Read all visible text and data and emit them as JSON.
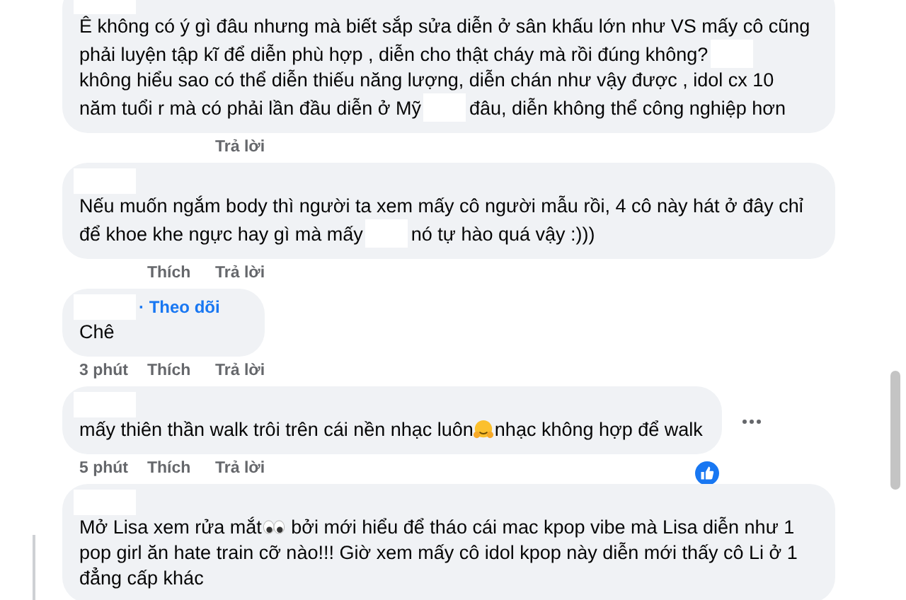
{
  "comments": [
    {
      "lines": [
        [
          {
            "kind": "text",
            "text": "Ê không có ý gì đâu nhưng mà biết sắp sửa diễn ở sân khấu lớn như VS mấy cô cũng"
          }
        ],
        [
          {
            "kind": "text",
            "text": "phải luyện tập kĩ để diễn phù hợp , diễn cho thật cháy mà rồi đúng không?"
          },
          {
            "kind": "redacted"
          }
        ],
        [
          {
            "kind": "text",
            "text": "không hiểu sao có thể diễn thiếu năng lượng, diễn chán như vậy được , idol cx 10"
          }
        ],
        [
          {
            "kind": "text",
            "text": "năm tuổi r mà có phải lần đầu diễn ở Mỹ"
          },
          {
            "kind": "redacted"
          },
          {
            "kind": "text",
            "text": "đâu, diễn không thể công nghiệp hơn"
          }
        ]
      ],
      "meta": {
        "reply": "Trả lời"
      }
    },
    {
      "lines": [
        [
          {
            "kind": "text",
            "text": "Nếu muốn ngắm body thì người ta xem mấy cô người mẫu rồi, 4 cô này hát ở đây chỉ"
          }
        ],
        [
          {
            "kind": "text",
            "text": "để khoe khe ngực hay gì mà mấy"
          },
          {
            "kind": "redacted"
          },
          {
            "kind": "text",
            "text": "nó tự hào quá vậy :)))"
          }
        ]
      ],
      "meta": {
        "like": "Thích",
        "reply": "Trả lời"
      }
    },
    {
      "follow": "· Theo dõi",
      "lines": [
        [
          {
            "kind": "text",
            "text": "Chê"
          }
        ]
      ],
      "meta": {
        "time": "3 phút",
        "like": "Thích",
        "reply": "Trả lời"
      }
    },
    {
      "lines": [
        [
          {
            "kind": "text",
            "text": "mấy thiên thần walk trôi trên cái nền nhạc luôn"
          },
          {
            "kind": "hug-emoji"
          },
          {
            "kind": "text",
            "text": "nhạc không hợp để walk"
          }
        ]
      ],
      "meta": {
        "time": "5 phút",
        "like": "Thích",
        "reply": "Trả lời"
      },
      "more": true,
      "liked": true
    },
    {
      "lines": [
        [
          {
            "kind": "text",
            "text": "Mở Lisa xem rửa mắt"
          },
          {
            "kind": "eyes-emoji"
          },
          {
            "kind": "text",
            "text": " bởi mới hiểu để tháo cái mac kpop vibe mà Lisa diễn như 1"
          }
        ],
        [
          {
            "kind": "text",
            "text": "pop girl ăn hate train cỡ nào!!! Giờ xem mấy cô idol kpop này diễn mới thấy cô Li ở 1"
          }
        ],
        [
          {
            "kind": "text",
            "text": "đẳng cấp khác"
          }
        ]
      ]
    }
  ]
}
